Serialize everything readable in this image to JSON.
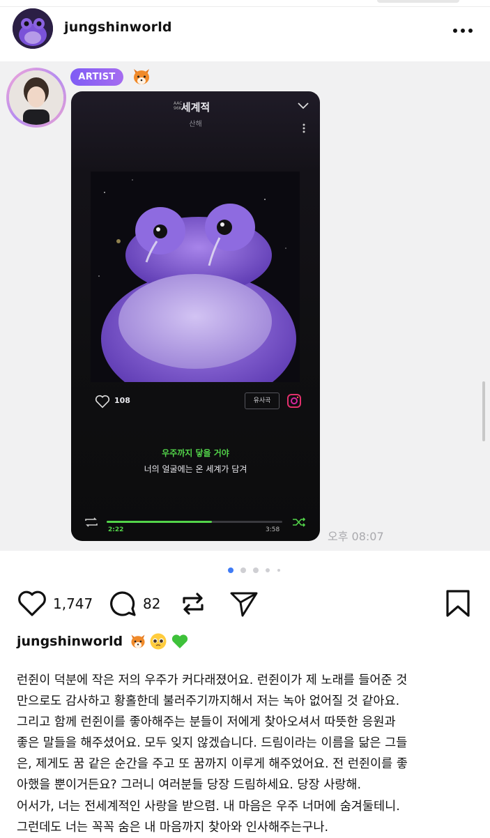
{
  "post": {
    "username": "jungshinworld",
    "more_icon": "more-horizontal-icon"
  },
  "chat": {
    "badge": "ARTIST",
    "badge_emoji": "fox-emoji",
    "timestamp": "오후 08:07"
  },
  "player": {
    "song_title": "세계적",
    "artist": "산해",
    "quality_badge_line1": "AAC",
    "quality_badge_line2": "96K",
    "likes": "108",
    "similar_label": "유사곡",
    "lyric_current": "우주까지 닿을 거야",
    "lyric_next": "너의 얼굴에는 온 세계가 담겨",
    "time_current": "2:22",
    "time_total": "3:58",
    "progress": 0.6
  },
  "carousel": {
    "count": 5,
    "active_index": 0
  },
  "actions": {
    "likes": "1,747",
    "comments": "82"
  },
  "caption": {
    "username": "jungshinworld",
    "emojis": [
      "fox-emoji",
      "pleading-face-emoji",
      "green-heart-emoji"
    ],
    "paragraph1": [
      "런쥔이 덕분에 작은 저의 우주가 커다래졌어요. 런쥔이가 제 노래를 들어준 것",
      "만으로도 감사하고 황홀한데 불러주기까지해서 저는 녹아 없어질 것 같아요.",
      "그리고 함께 런쥔이를 좋아해주는 분들이 저에게 찾아오셔서 따뜻한 응원과",
      "좋은 말들을 해주셨어요. 모두 잊지 않겠습니다. 드림이라는 이름을 닮은 그들",
      "은, 제게도 꿈 같은 순간을 주고 또 꿈까지 이루게 해주었어요. 전 런쥔이를 좋",
      "아했을 뿐이거든요? 그러니 여러분들 당장 드림하세요. 당장 사랑해."
    ],
    "paragraph2": [
      "어서가, 너는 전세계적인 사랑을 받으렴. 내 마음은 우주 너머에 숨겨둘테니.",
      "그런데도 너는 꼭꼭 숨은 내 마음까지 찾아와 인사해주는구나."
    ]
  }
}
